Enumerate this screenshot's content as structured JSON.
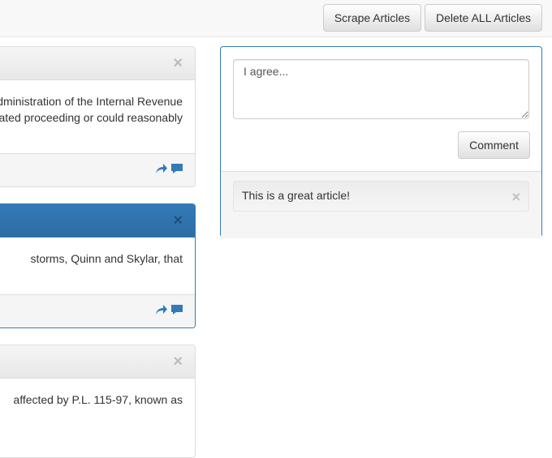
{
  "navbar": {
    "scrape_label": "Scrape Articles",
    "delete_label": "Delete ALL Articles"
  },
  "articles": [
    {
      "close": "×",
      "body_lines": [
        "dministration of the Internal Revenue",
        "ated proceeding or could reasonably"
      ]
    },
    {
      "close": "×",
      "body_lines": [
        "storms, Quinn and Skylar, that"
      ]
    },
    {
      "close": "×",
      "body_lines": [
        "affected by P.L. 115-97, known as"
      ]
    }
  ],
  "comment_box": {
    "placeholder": "I agree...",
    "submit_label": "Comment",
    "comments": [
      {
        "text": "This is a great article!",
        "close": "×"
      }
    ]
  },
  "colors": {
    "primary": "#337ab7"
  },
  "icons": [
    "share-arrow-icon",
    "comment-bubble-icon"
  ]
}
